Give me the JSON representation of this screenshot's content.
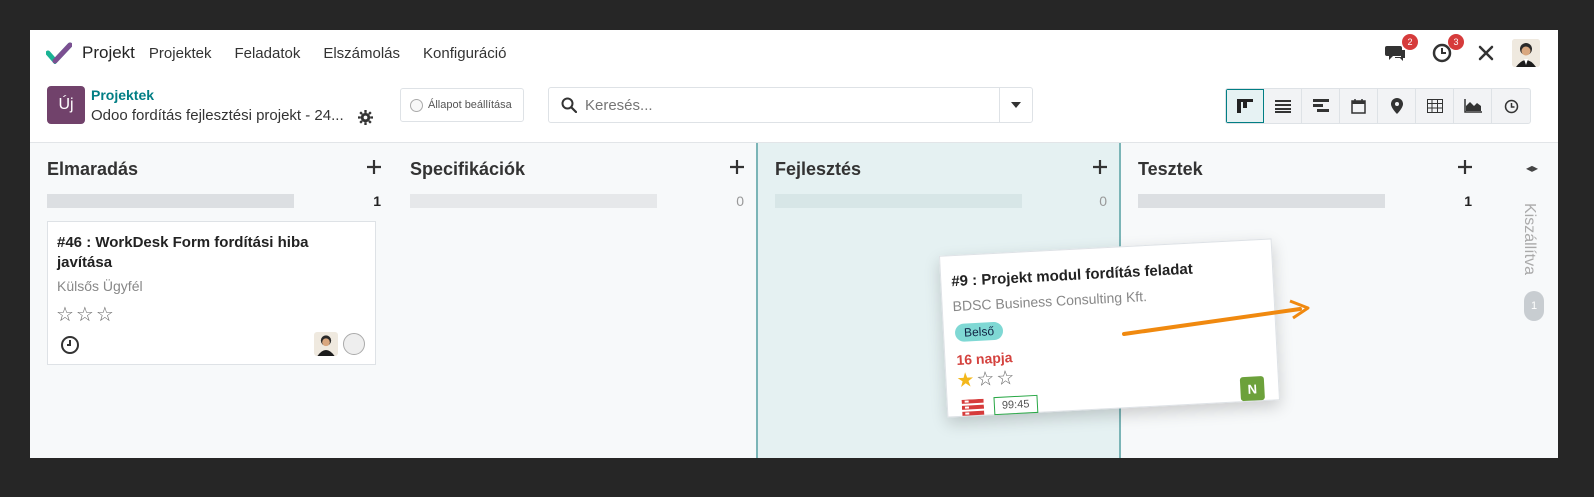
{
  "nav": {
    "brand": "Projekt",
    "menu": [
      "Projektek",
      "Feladatok",
      "Elszámolás",
      "Konfiguráció"
    ],
    "messages_badge": "2",
    "activities_badge": "3"
  },
  "control": {
    "new_label": "Új",
    "breadcrumb": "Projektek",
    "record_title": "Odoo fordítás fejlesztési projekt - 24...",
    "status_label": "Állapot beállítása",
    "search_placeholder": "Keresés..."
  },
  "columns": [
    {
      "title": "Elmaradás",
      "count": "1"
    },
    {
      "title": "Specifikációk",
      "count": "0"
    },
    {
      "title": "Fejlesztés",
      "count": "0"
    },
    {
      "title": "Tesztek",
      "count": "1"
    }
  ],
  "folded_column": {
    "label": "Kiszállítva",
    "count": "1"
  },
  "cards": {
    "task46": {
      "title": "#46 :  WorkDesk Form fordítási hiba javítása",
      "customer": "Külsős Ügyfél",
      "stars": "☆☆☆"
    },
    "task9": {
      "title": "#9 :  Projekt modul fordítás feladat",
      "customer": "BDSC Business Consulting Kft.",
      "tag": "Belső",
      "deadline": "16 napja",
      "star_filled": "★",
      "stars_empty": "☆☆",
      "time": "99:45",
      "user_initial": "N"
    }
  },
  "colors": {
    "brand": "#71426b",
    "accent": "#017e84",
    "drag_arrow": "#f0890f",
    "badge": "#d63b3b"
  }
}
